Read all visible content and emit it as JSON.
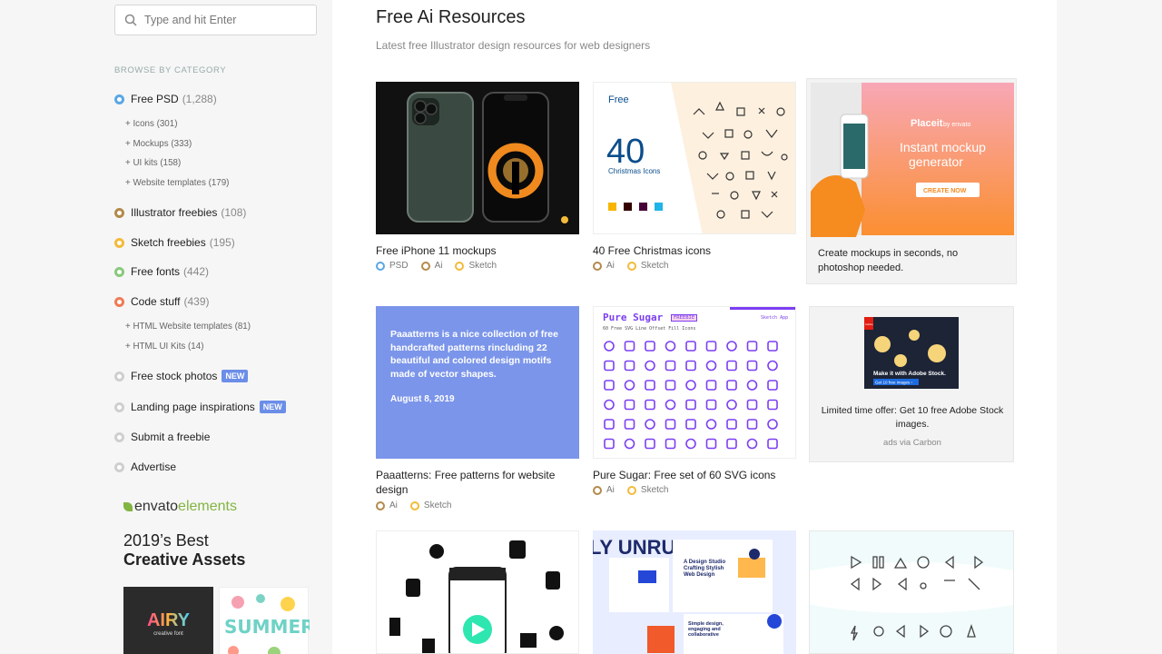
{
  "search": {
    "placeholder": "Type and hit Enter"
  },
  "sidebar": {
    "browse_label": "BROWSE BY CATEGORY",
    "categories": [
      {
        "label": "Free PSD",
        "count": "(1,288)",
        "color": "#5aa7e6"
      },
      {
        "label": "Illustrator freebies",
        "count": "(108)",
        "color": "#b38a4b"
      },
      {
        "label": "Sketch freebies",
        "count": "(195)",
        "color": "#f3bb3a"
      },
      {
        "label": "Free fonts",
        "count": "(442)",
        "color": "#88c97a"
      },
      {
        "label": "Code stuff",
        "count": "(439)",
        "color": "#ef7a55"
      },
      {
        "label": "Free stock photos",
        "count": "",
        "color": "#cfcfcf",
        "badge": "NEW"
      },
      {
        "label": "Landing page inspirations",
        "count": "",
        "color": "#cfcfcf",
        "badge": "NEW"
      },
      {
        "label": "Submit a freebie",
        "count": "",
        "color": "#cfcfcf"
      },
      {
        "label": "Advertise",
        "count": "",
        "color": "#cfcfcf"
      }
    ],
    "psd_subs": [
      "+ Icons (301)",
      "+ Mockups (333)",
      "+ UI kits (158)",
      "+ Website templates (179)"
    ],
    "code_subs": [
      "+ HTML Website templates (81)",
      "+ HTML UI Kits (14)"
    ],
    "envato": {
      "brand": "envato",
      "product": "elements",
      "line1": "2019’s Best",
      "line2": "Creative Assets",
      "thumb_word": "AIRY",
      "thumb_sub": "creative font",
      "thumb2_word": "SUMMER"
    }
  },
  "main": {
    "title": "Free Ai Resources",
    "subtitle": "Latest free Illustrator design resources for web designers",
    "cards": [
      {
        "name": "Free iPhone 11 mockups",
        "tags": [
          "PSD",
          "Ai",
          "Sketch"
        ]
      },
      {
        "name": "40 Free Christmas icons",
        "tags": [
          "Ai",
          "Sketch"
        ],
        "img_free": "Free",
        "img_num": "40",
        "img_sub": "Christmas Icons",
        "img_badges": [
          "Ai",
          "Xd"
        ]
      },
      {
        "name": "Paaatterns: Free patterns for website design",
        "tags": [
          "Ai",
          "Sketch"
        ],
        "img_text": "Paaatterns is a nice collection of free handcrafted patterns rincluding 22 beautiful and colored design motifs made of vector shapes.",
        "img_date": "August 8, 2019"
      },
      {
        "name": "Pure Sugar: Free set of 60 SVG icons",
        "tags": [
          "Ai",
          "Sketch"
        ],
        "img_title": "Pure Sugar",
        "img_badge": "FREEBIE",
        "img_sub": "60 Free SVG Line Offset Fill Icons",
        "img_app": "Sketch App"
      }
    ],
    "ad1": {
      "text": "Create mockups in seconds, no photoshop needed.",
      "brand": "Placeit",
      "brand_by": "by envato",
      "headline": "Instant mockup generator",
      "cta": "CREATE NOW"
    },
    "ad2": {
      "text": "Limited time offer: Get 10 free Adobe Stock images.",
      "via": "ads via Carbon",
      "img_title": "Make it with Adobe Stock.",
      "img_cta": "Get 10 free images ›",
      "img_logo": "Adobe"
    },
    "row3": {
      "unruled": "LY UNRUL",
      "studio_title": "A Design Studio Crafting Stylish Web Design",
      "simple": "Simple design, engaging and collaborative"
    }
  },
  "colors": {
    "psd": "#5aa7e6",
    "ai": "#b38a4b",
    "sketch": "#f3bb3a",
    "paaatterns_bg": "#7b95ea",
    "pure_sugar": "#7b3ff2"
  }
}
